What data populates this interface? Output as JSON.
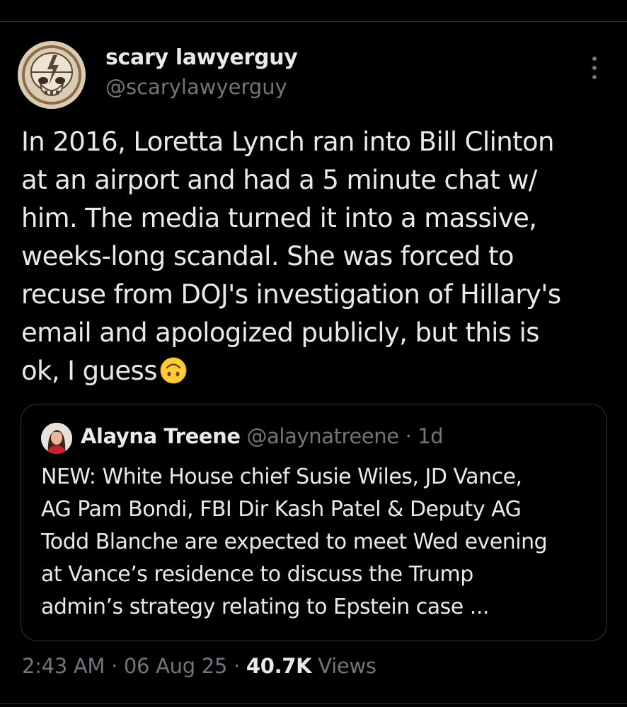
{
  "tweet": {
    "author": {
      "display_name": "scary lawyerguy",
      "handle": "@scarylawyerguy",
      "avatar_icon": "steal-your-face-skull-icon"
    },
    "more_icon": "more-options-icon",
    "text_lines": [
      "In 2016, Loretta Lynch ran into Bill Clinton",
      "at an airport and had a 5 minute chat w/",
      "him. The media turned it into a massive,",
      "weeks-long scandal. She was forced to",
      "recuse from DOJ's investigation of Hillary's",
      "email and apologized publicly, but this is",
      "ok, I guess"
    ],
    "emoji": "upside-down-face-emoji",
    "quoted": {
      "display_name": "Alayna Treene",
      "handle": "@alaynatreene",
      "separator": "·",
      "time": "1d",
      "text_lines": [
        "NEW: White House chief Susie Wiles, JD Vance,",
        "AG Pam Bondi, FBI Dir Kash Patel & Deputy AG",
        "Todd Blanche are expected to meet Wed evening",
        "at Vance’s residence to discuss the Trump",
        "admin’s strategy relating to Epstein case ..."
      ]
    },
    "meta": {
      "time": "2:43 AM",
      "sep1": "·",
      "date": "06 Aug 25",
      "sep2": "·",
      "views_count": "40.7K",
      "views_label": "Views"
    }
  },
  "colors": {
    "background": "#000000",
    "text": "#e7e9ea",
    "secondary_text": "#71767b",
    "border": "#2f3336"
  }
}
